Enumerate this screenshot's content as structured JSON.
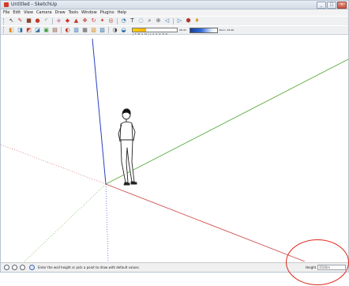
{
  "window": {
    "title": "Untitled - SketchUp",
    "controls": {
      "minimize": "_",
      "maximize": "□",
      "close": "×"
    }
  },
  "menu": {
    "items": [
      "File",
      "Edit",
      "View",
      "Camera",
      "Draw",
      "Tools",
      "Window",
      "Plugins",
      "Help"
    ]
  },
  "toolbar1": {
    "tools": [
      {
        "name": "select-icon",
        "glyph": "↖",
        "color": "#333333"
      },
      {
        "name": "pencil-icon",
        "glyph": "✎",
        "color": "#c0392b"
      },
      {
        "name": "rectangle-icon",
        "glyph": "■",
        "color": "#8a4a2a"
      },
      {
        "name": "circle-icon",
        "glyph": "●",
        "color": "#c0392b"
      },
      {
        "name": "arc-icon",
        "glyph": "◜",
        "color": "#444444"
      },
      {
        "name": "eraser-icon",
        "glyph": "◈",
        "color": "#d77aa0"
      },
      {
        "name": "paint-bucket-icon",
        "glyph": "◆",
        "color": "#d0342c"
      },
      {
        "name": "push-pull-icon",
        "glyph": "▲",
        "color": "#c0392b"
      },
      {
        "name": "move-icon",
        "glyph": "✥",
        "color": "#c0392b"
      },
      {
        "name": "rotate-icon",
        "glyph": "↻",
        "color": "#c0392b"
      },
      {
        "name": "follow-me-icon",
        "glyph": "✦",
        "color": "#c0392b"
      },
      {
        "name": "offset-icon",
        "glyph": "◎",
        "color": "#b03a2e"
      },
      {
        "name": "tape-measure-icon",
        "glyph": "◔",
        "color": "#2e6da4"
      },
      {
        "name": "text-icon",
        "glyph": "T",
        "color": "#333333"
      },
      {
        "name": "orbit-icon",
        "glyph": "◌",
        "color": "#2e6da4"
      },
      {
        "name": "zoom-icon",
        "glyph": "⌕",
        "color": "#333333"
      },
      {
        "name": "zoom-extents-icon",
        "glyph": "⊕",
        "color": "#555555"
      },
      {
        "name": "previous-view-icon",
        "glyph": "◁",
        "color": "#2e6da4"
      },
      {
        "name": "next-view-icon",
        "glyph": "▷",
        "color": "#2e6da4"
      },
      {
        "name": "get-models-icon",
        "glyph": "⬢",
        "color": "#b03a2e"
      },
      {
        "name": "share-model-icon",
        "glyph": "♦",
        "color": "#d4a017"
      }
    ]
  },
  "toolbar2": {
    "tools": [
      {
        "name": "iso-view-icon",
        "glyph": "◧",
        "color": "#d68a1c"
      },
      {
        "name": "top-view-icon",
        "glyph": "◨",
        "color": "#2e6da4"
      },
      {
        "name": "front-view-icon",
        "glyph": "◩",
        "color": "#c0392b"
      },
      {
        "name": "right-view-icon",
        "glyph": "◪",
        "color": "#2e6da4"
      },
      {
        "name": "back-view-icon",
        "glyph": "▣",
        "color": "#3a9a3a"
      },
      {
        "name": "left-view-icon",
        "glyph": "▤",
        "color": "#8a4a2a"
      },
      {
        "name": "xray-icon",
        "glyph": "◐",
        "color": "#c0392b"
      },
      {
        "name": "wireframe-icon",
        "glyph": "▥",
        "color": "#2e6da4"
      },
      {
        "name": "hidden-line-icon",
        "glyph": "▦",
        "color": "#555555"
      },
      {
        "name": "shaded-icon",
        "glyph": "▧",
        "color": "#d68a1c"
      },
      {
        "name": "textured-icon",
        "glyph": "▨",
        "color": "#2e6da4"
      },
      {
        "name": "shadows-icon",
        "glyph": "◑",
        "color": "#444444"
      },
      {
        "name": "fog-icon",
        "glyph": "◒",
        "color": "#2e6da4"
      }
    ],
    "shadow_scale": "J F M A M J J A S O N D",
    "time_start": "06:43",
    "time_mid": "Noon",
    "time_end": "04:46"
  },
  "scene": {
    "axis_colors": {
      "red": "#d14b4b",
      "green": "#5aaa3c",
      "blue": "#2b3fbf"
    }
  },
  "status": {
    "icons": [
      "geo-location-icon",
      "credits-icon",
      "user-icon",
      "info-icon"
    ],
    "message": "Enter the wall height or pick a point to draw with default values.",
    "measurement_label": "Height",
    "measurement_value": "3500m"
  },
  "highlight": {
    "color": "#e2231a"
  }
}
